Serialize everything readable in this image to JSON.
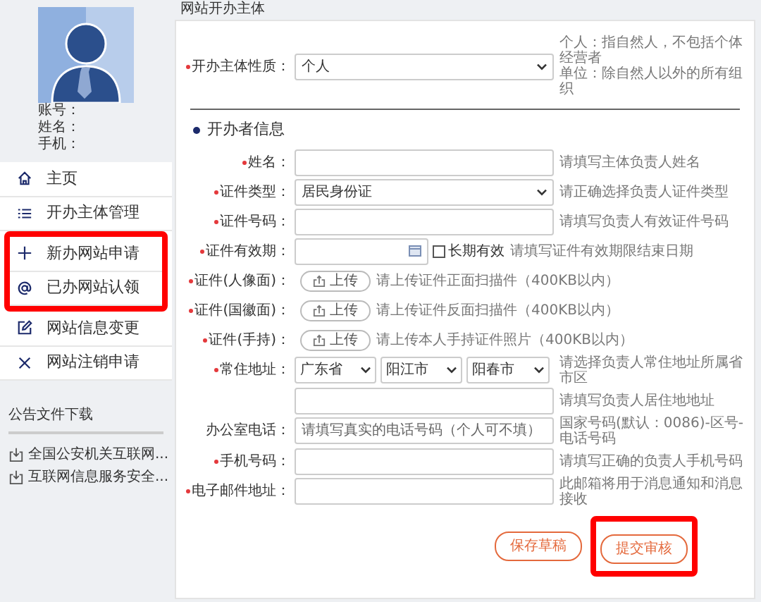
{
  "sidebar": {
    "profile": {
      "labels": [
        "账号：",
        "姓名：",
        "手机："
      ]
    },
    "nav": [
      {
        "label": "主页",
        "highlighted": false
      },
      {
        "label": "开办主体管理",
        "highlighted": false
      },
      {
        "label": "新办网站申请",
        "highlighted": true
      },
      {
        "label": "已办网站认领",
        "highlighted": true
      },
      {
        "label": "网站信息变更",
        "highlighted": false
      },
      {
        "label": "网站注销申请",
        "highlighted": false
      }
    ],
    "downloads": {
      "title": "公告文件下载",
      "items": [
        "全国公安机关互联网...",
        "互联网信息服务安全..."
      ]
    }
  },
  "panel": {
    "title": "网站开办主体",
    "subject": {
      "label": "开办主体性质：",
      "required": true,
      "value": "个人",
      "hints": [
        "个人：指自然人，不包括个体经营者",
        "单位：除自然人以外的所有组织"
      ]
    },
    "section_title": "开办者信息",
    "rows": [
      {
        "kind": "text",
        "label": "姓名：",
        "required": true,
        "hint": "请填写主体负责人姓名"
      },
      {
        "kind": "select",
        "label": "证件类型：",
        "required": true,
        "value": "居民身份证",
        "hint": "请正确选择负责人证件类型"
      },
      {
        "kind": "text",
        "label": "证件号码：",
        "required": true,
        "hint": "请填写负责人有效证件号码"
      },
      {
        "kind": "date",
        "label": "证件有效期：",
        "required": true,
        "checkbox": {
          "label": "长期有效",
          "checked": false
        },
        "hint": "请填写证件有效期限结束日期"
      },
      {
        "kind": "upload",
        "label": "证件(人像面)：",
        "required": true,
        "button": "上传",
        "hint": "请上传证件正面扫描件（400KB以内）"
      },
      {
        "kind": "upload",
        "label": "证件(国徽面)：",
        "required": true,
        "button": "上传",
        "hint": "请上传证件反面扫描件（400KB以内）"
      },
      {
        "kind": "upload",
        "label": "证件(手持)：",
        "required": true,
        "button": "上传",
        "hint": "请上传本人手持证件照片（400KB以内）"
      },
      {
        "kind": "address",
        "label": "常住地址：",
        "required": true,
        "values": [
          "广东省",
          "阳江市",
          "阳春市"
        ],
        "hint": "请选择负责人常住地址所属省市区"
      },
      {
        "kind": "text",
        "hint": "请填写负责人居住地地址"
      },
      {
        "kind": "text",
        "label": "办公室电话：",
        "required": false,
        "placeholder": "请填写真实的电话号码（个人可不填）",
        "hint": "国家号码(默认：0086)-区号-电话号码"
      },
      {
        "kind": "text",
        "label": "手机号码：",
        "required": true,
        "hint": "请填写正确的负责人手机号码"
      },
      {
        "kind": "text",
        "label": "电子邮件地址：",
        "required": true,
        "hint": "此邮箱将用于消息通知和消息接收"
      }
    ],
    "buttons": [
      {
        "label": "保存草稿",
        "highlighted": false
      },
      {
        "label": "提交审核",
        "highlighted": true
      }
    ]
  }
}
